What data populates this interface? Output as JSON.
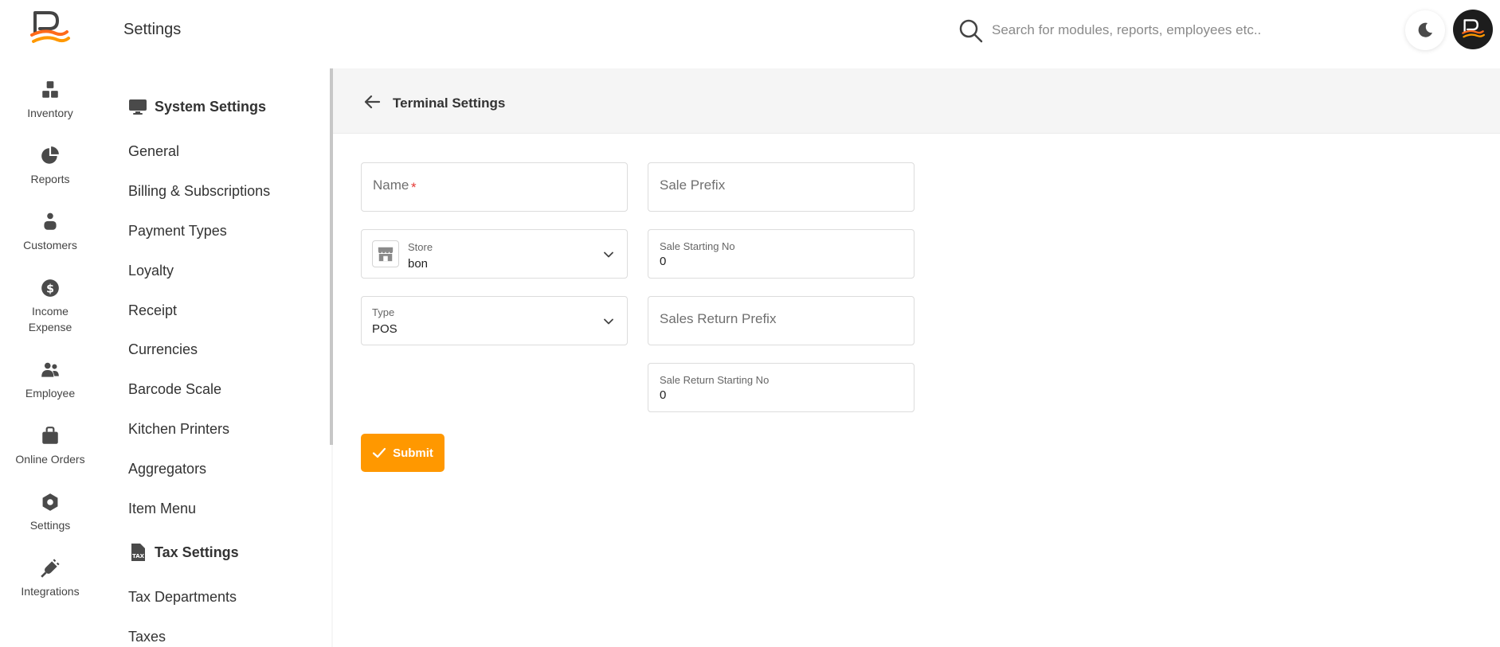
{
  "rail": {
    "items": [
      {
        "label": "Inventory",
        "icon": "boxes-icon"
      },
      {
        "label": "Reports",
        "icon": "pie-chart-icon"
      },
      {
        "label": "Customers",
        "icon": "customers-icon"
      },
      {
        "label": "Income Expense",
        "label_line1": "Income",
        "label_line2": "Expense",
        "icon": "dollar-icon"
      },
      {
        "label": "Employee",
        "icon": "employee-icon"
      },
      {
        "label": "Online Orders",
        "icon": "bag-icon"
      },
      {
        "label": "Settings",
        "icon": "gear-icon"
      },
      {
        "label": "Integrations",
        "icon": "plug-icon"
      }
    ]
  },
  "topbar": {
    "title": "Settings",
    "search_placeholder": "Search for modules, reports, employees etc.."
  },
  "settings_nav": {
    "system_heading": "System Settings",
    "system_items": [
      "General",
      "Billing & Subscriptions",
      "Payment Types",
      "Loyalty",
      "Receipt",
      "Currencies",
      "Barcode Scale",
      "Kitchen Printers",
      "Aggregators",
      "Item Menu"
    ],
    "tax_heading": "Tax Settings",
    "tax_items": [
      "Tax Departments",
      "Taxes"
    ],
    "tax_icon_text": "TAX"
  },
  "content": {
    "title": "Terminal Settings",
    "form": {
      "name_placeholder": "Name",
      "name_required_mark": "*",
      "store_label": "Store",
      "store_value": "bon",
      "type_label": "Type",
      "type_value": "POS",
      "sale_prefix_placeholder": "Sale Prefix",
      "sale_starting_no_label": "Sale Starting No",
      "sale_starting_no_value": "0",
      "sales_return_prefix_placeholder": "Sales Return Prefix",
      "sale_return_starting_no_label": "Sale Return Starting No",
      "sale_return_starting_no_value": "0"
    },
    "submit_label": "Submit"
  },
  "colors": {
    "accent": "#ff9800",
    "required": "#e53935",
    "brand_dark": "#1d1d1d"
  }
}
